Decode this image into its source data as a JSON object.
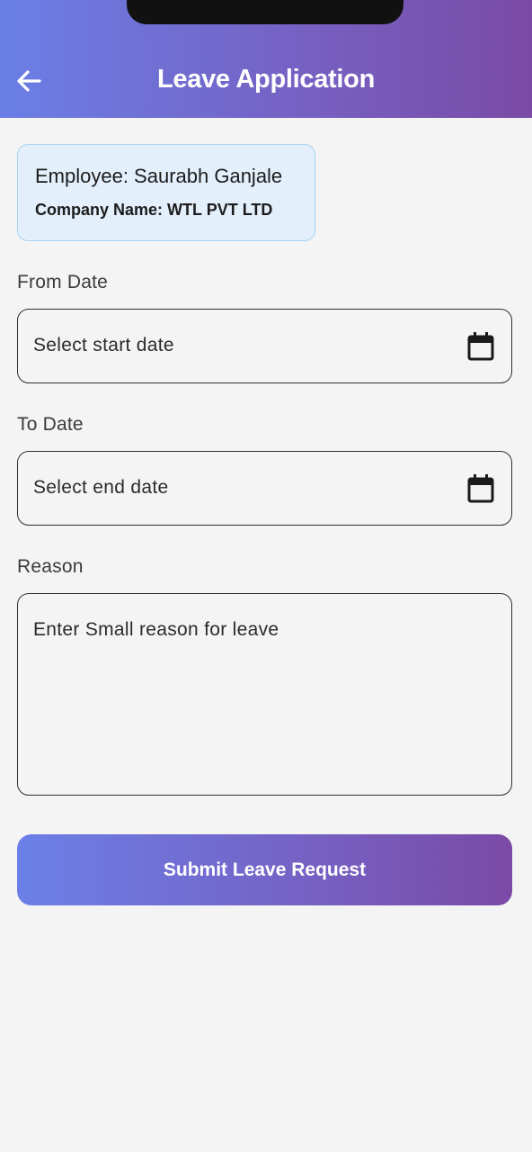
{
  "header": {
    "title": "Leave Application",
    "back_icon": "arrow-left-icon"
  },
  "employee_card": {
    "employee": "Employee: Saurabh Ganjale",
    "company": "Company Name: WTL PVT LTD"
  },
  "form": {
    "from_date": {
      "label": "From Date",
      "placeholder": "Select start date",
      "icon": "calendar-icon"
    },
    "to_date": {
      "label": "To Date",
      "placeholder": "Select end date",
      "icon": "calendar-icon"
    },
    "reason": {
      "label": "Reason",
      "placeholder": "Enter Small reason for leave"
    },
    "submit_label": "Submit Leave Request"
  },
  "colors": {
    "gradient_start": "#6a7fe6",
    "gradient_end": "#7a4aa6",
    "card_bg": "#e3effb",
    "card_border": "#a8d2f2",
    "page_bg": "#f4f4f4"
  }
}
